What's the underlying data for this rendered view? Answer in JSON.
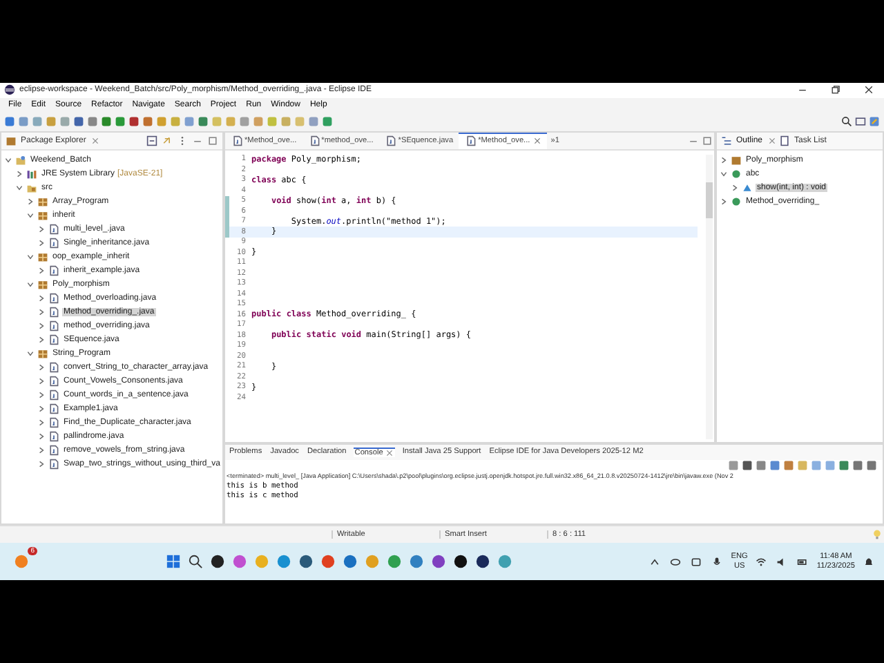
{
  "window": {
    "title": "eclipse-workspace - Weekend_Batch/src/Poly_morphism/Method_overriding_.java - Eclipse IDE"
  },
  "menu": [
    "File",
    "Edit",
    "Source",
    "Refactor",
    "Navigate",
    "Search",
    "Project",
    "Run",
    "Window",
    "Help"
  ],
  "package_explorer": {
    "title": "Package Explorer",
    "tree": [
      {
        "label": "Weekend_Batch",
        "kind": "project",
        "expanded": true,
        "selected": false,
        "children": [
          {
            "label": "JRE System Library",
            "suffix": "[JavaSE-21]",
            "kind": "library",
            "expanded": false,
            "selected": false
          },
          {
            "label": "src",
            "kind": "folder",
            "expanded": true,
            "selected": false,
            "children": [
              {
                "label": "Array_Program",
                "kind": "package",
                "expanded": false,
                "selected": false
              },
              {
                "label": "inherit",
                "kind": "package",
                "expanded": true,
                "selected": false,
                "children": [
                  {
                    "label": "multi_level_.java",
                    "kind": "file",
                    "expanded": false,
                    "selected": false
                  },
                  {
                    "label": "Single_inheritance.java",
                    "kind": "file",
                    "expanded": false,
                    "selected": false
                  }
                ]
              },
              {
                "label": "oop_example_inherit",
                "kind": "package",
                "expanded": true,
                "selected": false,
                "children": [
                  {
                    "label": "inherit_example.java",
                    "kind": "file",
                    "expanded": false,
                    "selected": false
                  }
                ]
              },
              {
                "label": "Poly_morphism",
                "kind": "package",
                "expanded": true,
                "selected": false,
                "children": [
                  {
                    "label": "Method_overloading.java",
                    "kind": "file",
                    "expanded": false,
                    "selected": false
                  },
                  {
                    "label": "Method_overriding_.java",
                    "kind": "file",
                    "expanded": false,
                    "selected": true
                  },
                  {
                    "label": "method_overriding.java",
                    "kind": "file",
                    "expanded": false,
                    "selected": false
                  },
                  {
                    "label": "SEquence.java",
                    "kind": "file",
                    "expanded": false,
                    "selected": false
                  }
                ]
              },
              {
                "label": "String_Program",
                "kind": "package",
                "expanded": true,
                "selected": false,
                "children": [
                  {
                    "label": "convert_String_to_character_array.java",
                    "kind": "file",
                    "expanded": false,
                    "selected": false
                  },
                  {
                    "label": "Count_Vowels_Consonents.java",
                    "kind": "file",
                    "expanded": false,
                    "selected": false
                  },
                  {
                    "label": "Count_words_in_a_sentence.java",
                    "kind": "file",
                    "expanded": false,
                    "selected": false
                  },
                  {
                    "label": "Example1.java",
                    "kind": "file",
                    "expanded": false,
                    "selected": false
                  },
                  {
                    "label": "Find_the_Duplicate_character.java",
                    "kind": "file",
                    "expanded": false,
                    "selected": false
                  },
                  {
                    "label": "pallindrome.java",
                    "kind": "file",
                    "expanded": false,
                    "selected": false
                  },
                  {
                    "label": "remove_vowels_from_string.java",
                    "kind": "file",
                    "expanded": false,
                    "selected": false
                  },
                  {
                    "label": "Swap_two_strings_without_using_third_va",
                    "kind": "file",
                    "expanded": false,
                    "selected": false
                  }
                ]
              }
            ]
          }
        ]
      }
    ]
  },
  "editor": {
    "tabs": [
      {
        "label": "*Method_ove...",
        "selected": false
      },
      {
        "label": "*method_ove...",
        "selected": false
      },
      {
        "label": "*SEquence.java",
        "selected": false
      },
      {
        "label": "*Method_ove...",
        "selected": true
      }
    ],
    "overflow": "»1",
    "lines": [
      {
        "number": "1",
        "code": "**package** Poly_morphism;",
        "changed": false,
        "current": false
      },
      {
        "number": "2",
        "changed": false,
        "current": false
      },
      {
        "number": "3",
        "code": "**class** abc {",
        "changed": false,
        "current": false
      },
      {
        "number": "4",
        "changed": false,
        "current": false
      },
      {
        "number": "5",
        "code": "    **void** show(**int** a, **int** b) {",
        "changed": true,
        "current": false
      },
      {
        "number": "6",
        "changed": true,
        "current": false
      },
      {
        "number": "7",
        "code": "        System.*out*.println(\"method 1\");",
        "changed": true,
        "current": false
      },
      {
        "number": "8",
        "code": "    }",
        "changed": true,
        "current": true
      },
      {
        "number": "9",
        "changed": false,
        "current": false
      },
      {
        "number": "10",
        "code": "}",
        "changed": false,
        "current": false
      },
      {
        "number": "11",
        "changed": false,
        "current": false
      },
      {
        "number": "12",
        "changed": false,
        "current": false
      },
      {
        "number": "13",
        "changed": false,
        "current": false
      },
      {
        "number": "14",
        "changed": false,
        "current": false
      },
      {
        "number": "15",
        "changed": false,
        "current": false
      },
      {
        "number": "16",
        "code": "**public** **class** Method_overriding_ {",
        "changed": false,
        "current": false
      },
      {
        "number": "17",
        "changed": false,
        "current": false
      },
      {
        "number": "18",
        "code": "    **public** **static** **void** main(String[] args) {",
        "changed": false,
        "current": false
      },
      {
        "number": "19",
        "changed": false,
        "current": false
      },
      {
        "number": "20",
        "changed": false,
        "current": false
      },
      {
        "number": "21",
        "code": "    }",
        "changed": false,
        "current": false
      },
      {
        "number": "22",
        "changed": false,
        "current": false
      },
      {
        "number": "23",
        "code": "}",
        "changed": false,
        "current": false
      },
      {
        "number": "24",
        "changed": false,
        "current": false
      }
    ]
  },
  "outline": {
    "tabs": [
      {
        "label": "Outline",
        "selected": true
      },
      {
        "label": "Task List",
        "selected": false
      }
    ],
    "tree": [
      {
        "label": "Poly_morphism",
        "kind": "package",
        "expanded": false,
        "selected": false
      },
      {
        "label": "abc",
        "kind": "class",
        "expanded": true,
        "selected": false,
        "children": [
          {
            "label": "show(int, int) : void",
            "kind": "method",
            "expanded": false,
            "selected": true
          }
        ]
      },
      {
        "label": "Method_overriding_",
        "kind": "class",
        "expanded": false,
        "selected": false
      }
    ]
  },
  "console": {
    "tabs": [
      {
        "label": "Problems",
        "selected": false
      },
      {
        "label": "Javadoc",
        "selected": false
      },
      {
        "label": "Declaration",
        "selected": false
      },
      {
        "label": "Console",
        "selected": true
      },
      {
        "label": "Install Java 25 Support",
        "selected": false
      },
      {
        "label": "Eclipse IDE for Java Developers 2025-12 M2",
        "selected": false
      }
    ],
    "header": "<terminated> multi_level_ [Java Application] C:\\Users\\shada\\.p2\\pool\\plugins\\org.eclipse.justj.openjdk.hotspot.jre.full.win32.x86_64_21.0.8.v20250724-1412\\jre\\bin\\javaw.exe  (Nov 2",
    "output": [
      "this is b method",
      "this is c method"
    ]
  },
  "status_bar": [
    "Writable",
    "Smart Insert",
    "8 : 6 : 111"
  ],
  "taskbar": {
    "notification_count": "6",
    "language": "ENG",
    "region": "US",
    "time": "11:48 AM",
    "date": "11/23/2025"
  }
}
